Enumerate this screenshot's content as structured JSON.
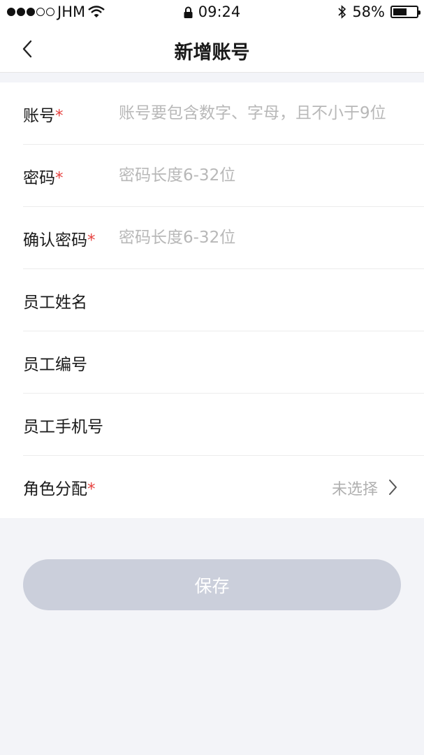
{
  "status_bar": {
    "carrier": "JHM",
    "time": "09:24",
    "battery": "58%",
    "battery_level": 0.58,
    "signal_bars_filled": 3,
    "signal_bars_total": 5,
    "icons": [
      "wifi-icon",
      "lock-icon",
      "bluetooth-icon",
      "battery-icon"
    ]
  },
  "nav": {
    "title": "新增账号",
    "back_icon": "chevron-left-icon"
  },
  "form": {
    "rows": [
      {
        "label": "账号",
        "required": "*",
        "placeholder": "账号要包含数字、字母，且不小于9位",
        "value": ""
      },
      {
        "label": "密码",
        "required": "*",
        "placeholder": "密码长度6-32位",
        "value": ""
      },
      {
        "label": "确认密码",
        "required": "*",
        "placeholder": "密码长度6-32位",
        "value": ""
      },
      {
        "label": "员工姓名",
        "placeholder": "",
        "value": ""
      },
      {
        "label": "员工编号",
        "placeholder": "",
        "value": ""
      },
      {
        "label": "员工手机号",
        "placeholder": "",
        "value": ""
      }
    ],
    "role": {
      "label": "角色分配",
      "required": "*",
      "value": "未选择",
      "icon": "chevron-right-icon"
    }
  },
  "save_button": {
    "label": "保存"
  },
  "colors": {
    "required": "#e64340",
    "placeholder": "#b8b8b8",
    "button_disabled": "#cbcfdb",
    "page_background": "#f3f4f8"
  }
}
